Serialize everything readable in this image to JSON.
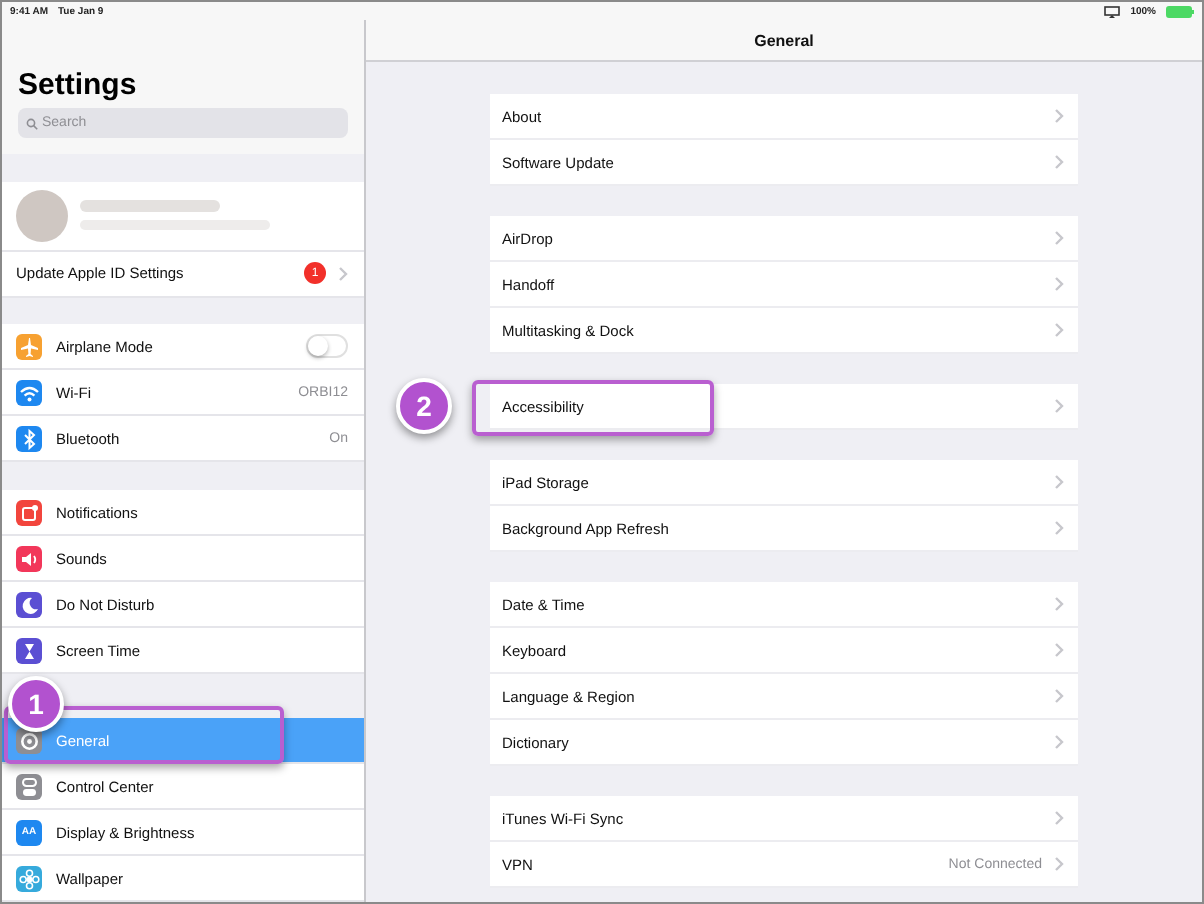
{
  "status_bar": {
    "time": "9:41 AM",
    "date": "Tue Jan 9",
    "battery": "100%"
  },
  "sidebar": {
    "title": "Settings",
    "search": {
      "placeholder": "Search"
    },
    "groups": [
      {
        "items": [
          {
            "kind": "profile"
          },
          {
            "kind": "badge",
            "label": "Update Apple ID Settings",
            "badge": "1",
            "selected": false
          }
        ]
      },
      {
        "items": [
          {
            "kind": "toggle",
            "label": "Airplane Mode",
            "color": "#f7a131",
            "on": false,
            "selected": false
          },
          {
            "kind": "value",
            "label": "Wi-Fi",
            "value": "ORBI12",
            "color": "#1e88f0",
            "selected": false
          },
          {
            "kind": "value",
            "label": "Bluetooth",
            "value": "On",
            "color": "#1e88f0",
            "selected": false
          }
        ]
      },
      {
        "items": [
          {
            "kind": "plain",
            "label": "Notifications",
            "color": "#f2453d",
            "selected": false
          },
          {
            "kind": "plain",
            "label": "Sounds",
            "color": "#f2375a",
            "selected": false
          },
          {
            "kind": "plain",
            "label": "Do Not Disturb",
            "color": "#5b4fd3",
            "selected": false
          },
          {
            "kind": "plain",
            "label": "Screen Time",
            "color": "#5b4fd3",
            "selected": false
          }
        ]
      },
      {
        "items": [
          {
            "kind": "plain",
            "label": "General",
            "color": "#8e8e93",
            "selected": true,
            "callout": "1"
          },
          {
            "kind": "plain",
            "label": "Control Center",
            "color": "#8e8e93",
            "selected": false
          },
          {
            "kind": "plain",
            "label": "Display & Brightness",
            "color": "#1e88f0",
            "icon_text": "AA",
            "selected": false
          },
          {
            "kind": "plain",
            "label": "Wallpaper",
            "color": "#36aadc",
            "selected": false
          }
        ]
      }
    ]
  },
  "detail": {
    "title": "General",
    "groups": [
      [
        {
          "label": "About"
        },
        {
          "label": "Software Update"
        }
      ],
      [
        {
          "label": "AirDrop"
        },
        {
          "label": "Handoff"
        },
        {
          "label": "Multitasking & Dock"
        }
      ],
      [
        {
          "label": "Accessibility",
          "callout": "2"
        }
      ],
      [
        {
          "label": "iPad Storage"
        },
        {
          "label": "Background App Refresh"
        }
      ],
      [
        {
          "label": "Date & Time"
        },
        {
          "label": "Keyboard"
        },
        {
          "label": "Language & Region"
        },
        {
          "label": "Dictionary"
        }
      ],
      [
        {
          "label": "iTunes Wi-Fi Sync"
        },
        {
          "label": "VPN",
          "value": "Not Connected"
        }
      ]
    ]
  }
}
